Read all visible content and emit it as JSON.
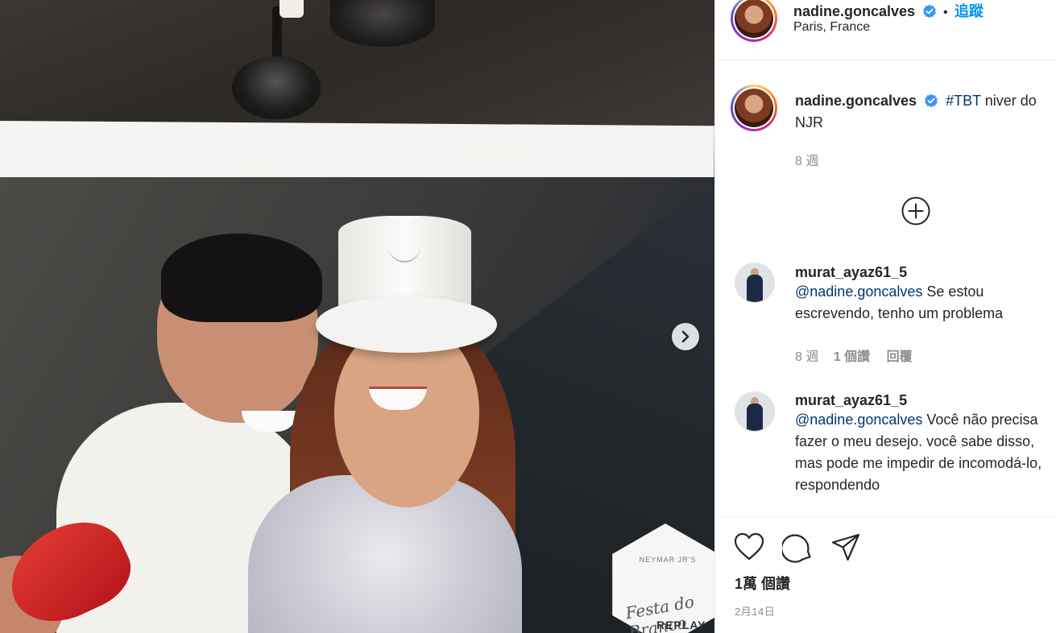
{
  "post": {
    "username": "nadine.goncalves",
    "dot": "•",
    "follow_label": "追蹤",
    "location": "Paris, France",
    "caption_hashtag": "#TBT",
    "caption_rest": " niver do",
    "caption_line2": "NJR",
    "caption_time": "8 週",
    "load_more_icon": "plus-circle-icon",
    "likes_label": "1萬 個讚",
    "date": "2月14日"
  },
  "photo": {
    "badge_title": "NEYMAR JR'S",
    "badge_script": "Festa do Branco",
    "badge_replay": "REPLAY"
  },
  "comments": [
    {
      "username": "murat_ayaz61_5",
      "mention": "@nadine.goncalves",
      "text": " Se estou escrevendo, tenho um problema",
      "time": "8 週",
      "likes": "1 個讚",
      "reply": "回覆"
    },
    {
      "username": "murat_ayaz61_5",
      "mention": "@nadine.goncalves",
      "text": " Você não precisa fazer o meu desejo. você sabe disso, mas pode me impedir de incomodá-lo, respondendo"
    }
  ],
  "icons": {
    "like": "heart-icon",
    "comment": "comment-bubble-icon",
    "share": "paper-plane-icon",
    "next": "chevron-right-icon",
    "verified": "verified-badge-icon"
  },
  "colors": {
    "link": "#0095f6",
    "hashtag": "#00376b",
    "verified": "#3897f0",
    "muted": "#8e8e8e"
  }
}
